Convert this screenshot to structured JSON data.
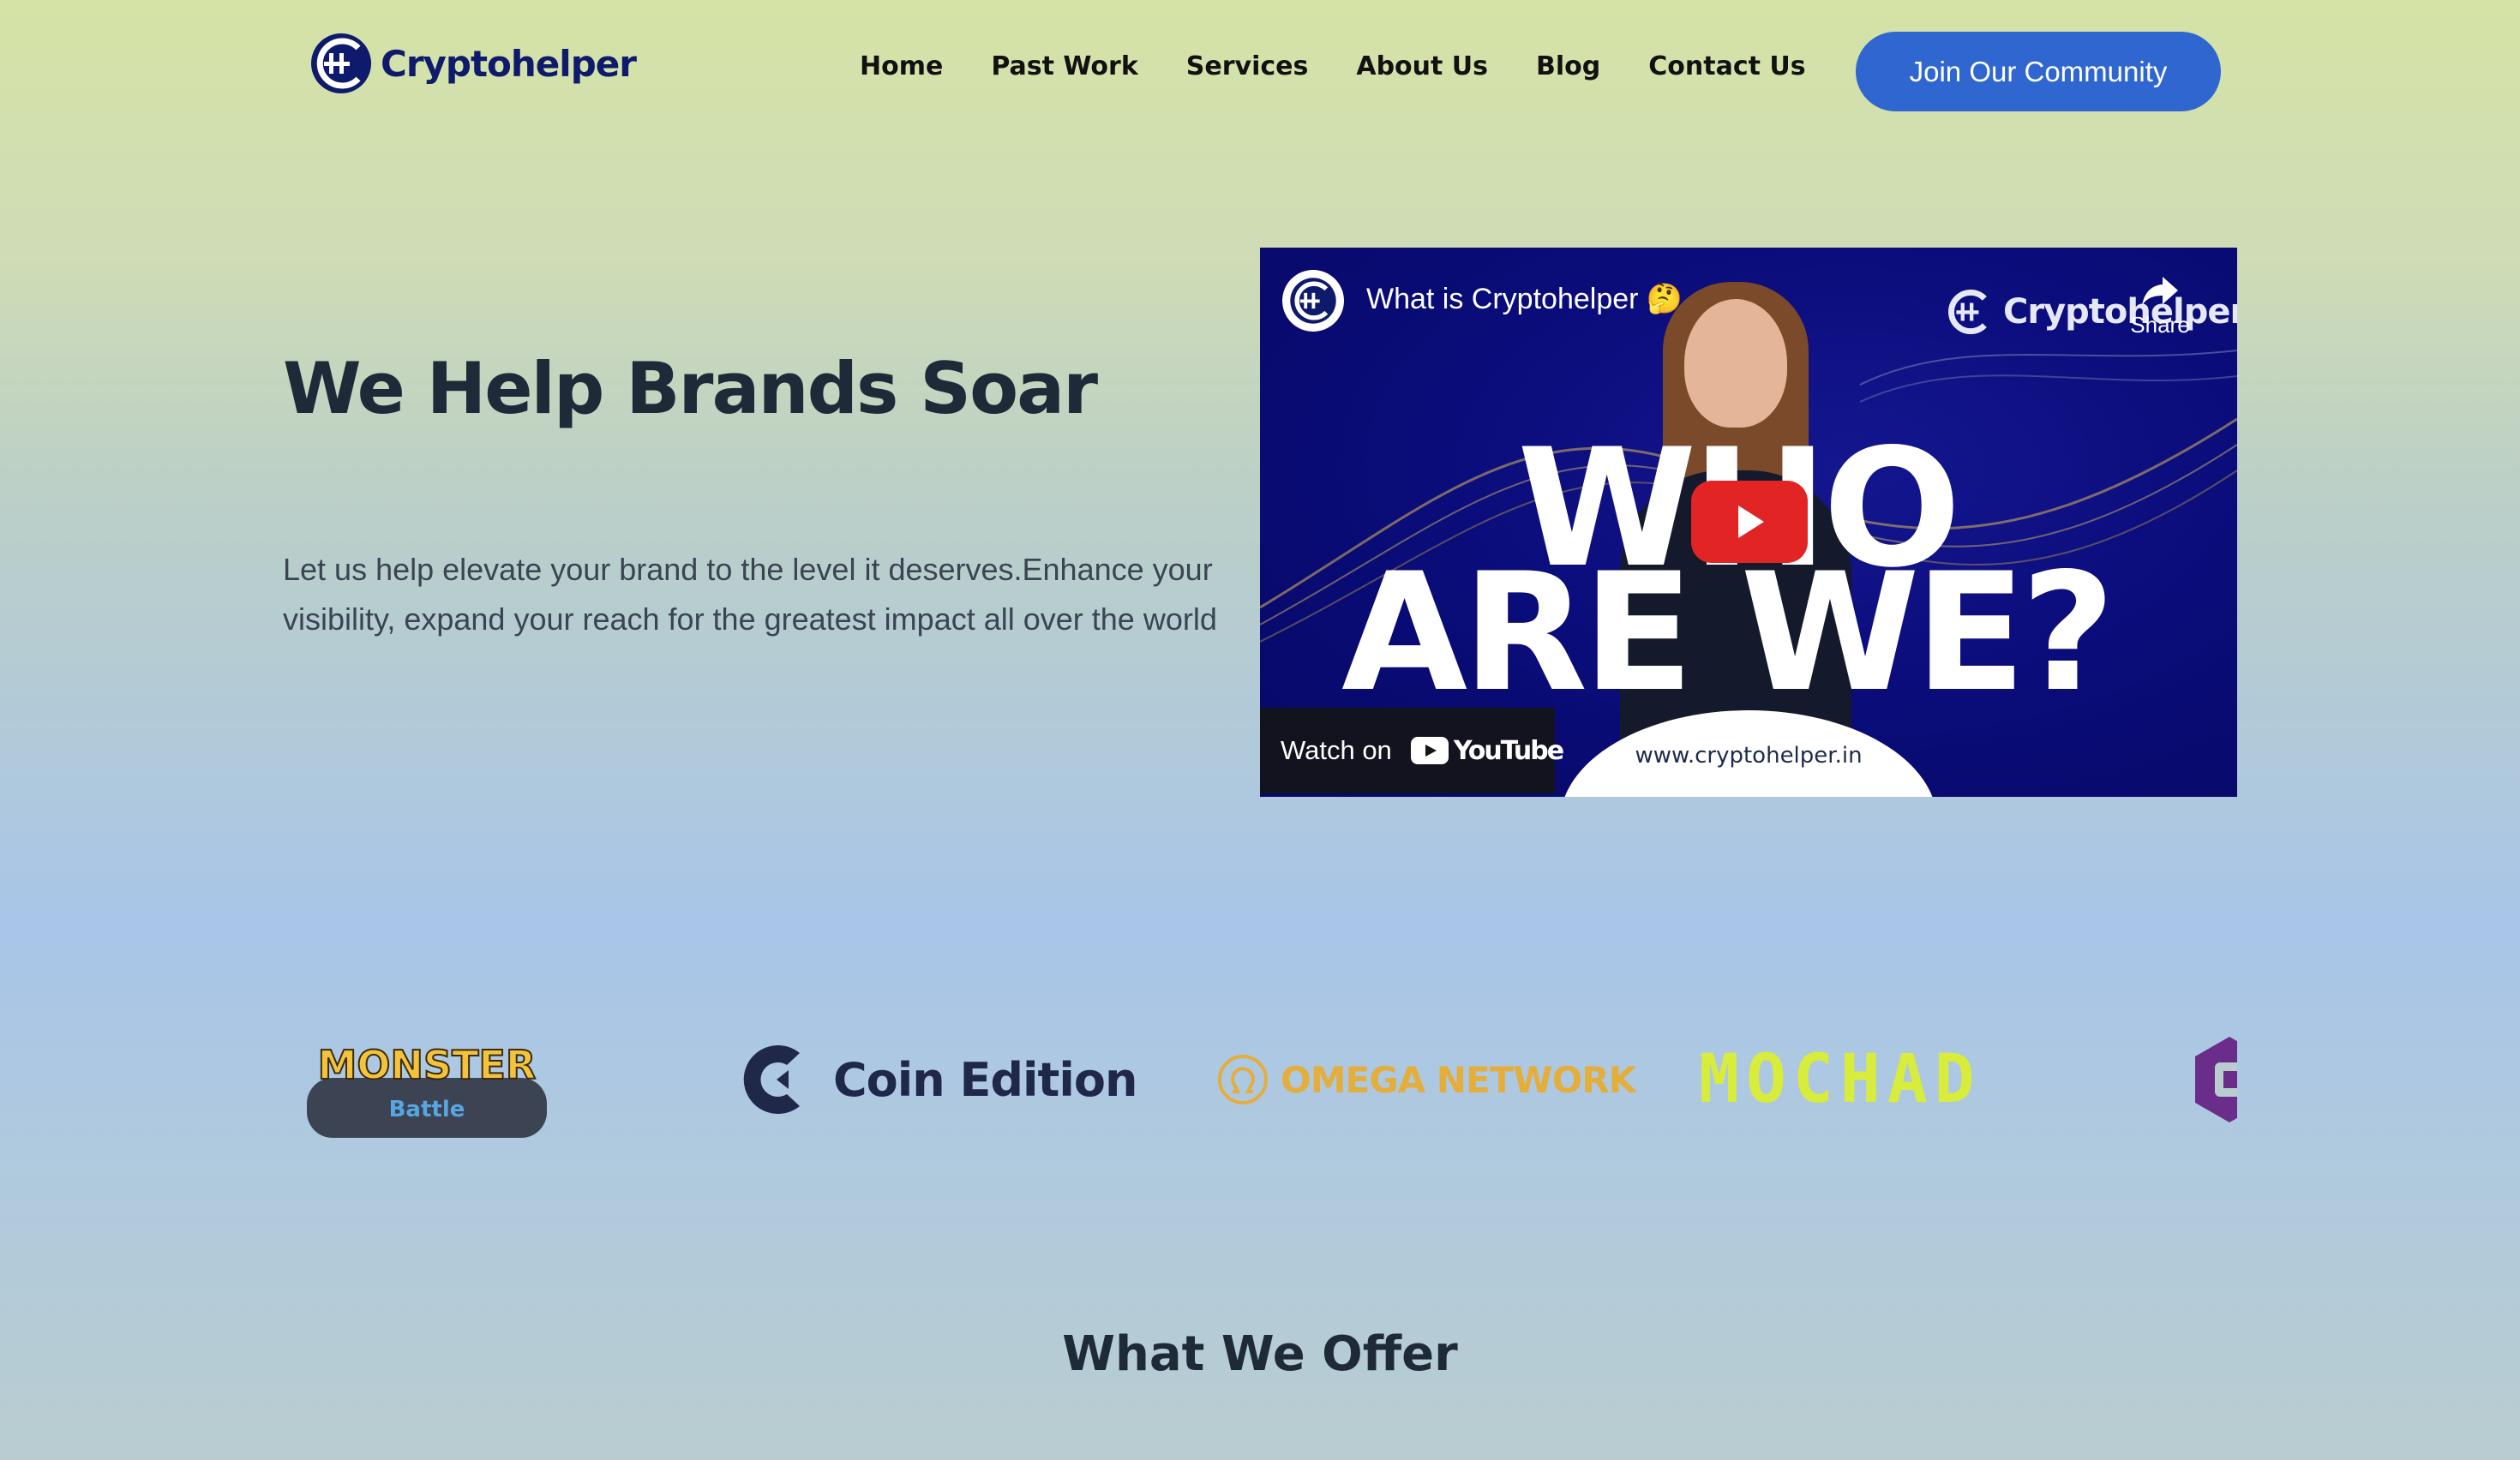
{
  "header": {
    "logo_text": "Cryptohelper",
    "nav": [
      "Home",
      "Past Work",
      "Services",
      "About Us",
      "Blog",
      "Contact Us"
    ],
    "cta_label": "Join Our Community"
  },
  "hero": {
    "title": "We Help Brands Soar",
    "description": "Let us help elevate your brand to the level it deserves.Enhance your visibility, expand your reach for the greatest impact all over the world"
  },
  "video": {
    "title": "What is Cryptohelper 🤔",
    "brand": "Cryptohelper",
    "share_label": "Share",
    "headline_line1": "WHO",
    "headline_line2": "ARE WE?",
    "watch_label": "Watch on",
    "youtube_word": "YouTube",
    "url": "www.cryptohelper.in",
    "play_color": "#e32424"
  },
  "partners": [
    {
      "name": "Monster Battle",
      "line1": "MONSTER",
      "line2": "Battle"
    },
    {
      "name": "Coin Edition"
    },
    {
      "name": "OMEGA NETWORK"
    },
    {
      "name": "MOCHAD"
    }
  ],
  "section": {
    "title": "What We Offer"
  },
  "colors": {
    "brand_navy": "#0e1a6b",
    "cta_blue": "#2f66d0",
    "omega_gold": "#e4ae3c",
    "mochad_lime": "#d8ec3c"
  }
}
